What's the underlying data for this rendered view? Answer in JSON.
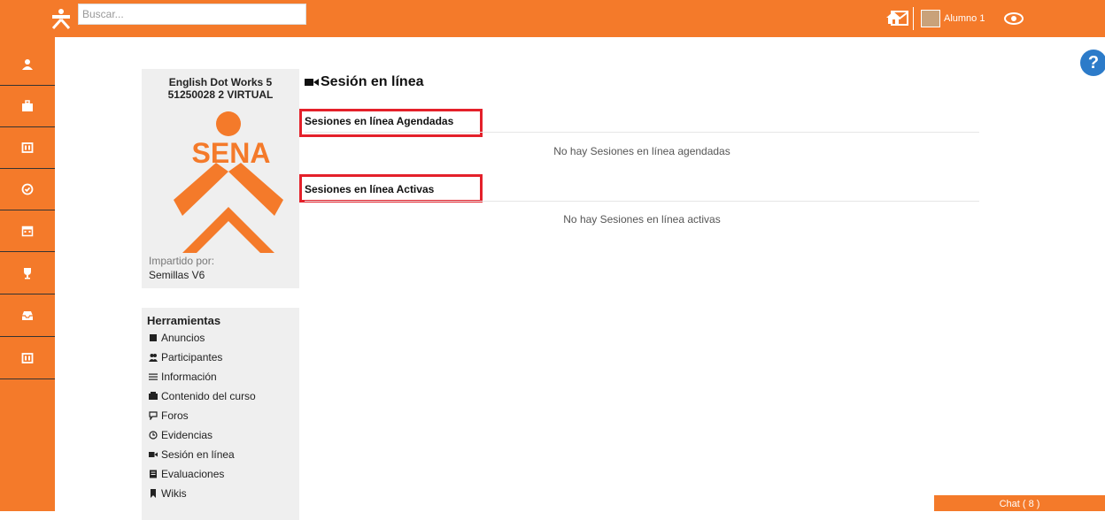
{
  "header": {
    "search_placeholder": "Buscar...",
    "user_name": "Alumno 1"
  },
  "sidebar": {
    "items": [
      {
        "icon": "user-icon"
      },
      {
        "icon": "briefcase-icon"
      },
      {
        "icon": "book-icon"
      },
      {
        "icon": "check-circle-icon"
      },
      {
        "icon": "calendar-icon"
      },
      {
        "icon": "trophy-icon"
      },
      {
        "icon": "inbox-icon"
      },
      {
        "icon": "book-icon"
      }
    ]
  },
  "course": {
    "title_line1": "English Dot Works 5",
    "title_line2": "51250028 2 VIRTUAL",
    "logo_text": "SENA",
    "taught_by_label": "Impartido por:",
    "taught_by_value": "Semillas V6"
  },
  "tools": {
    "title": "Herramientas",
    "items": [
      {
        "label": "Anuncios",
        "icon": "announcement-icon"
      },
      {
        "label": "Participantes",
        "icon": "users-icon"
      },
      {
        "label": "Información",
        "icon": "list-icon"
      },
      {
        "label": "Contenido del curso",
        "icon": "content-icon"
      },
      {
        "label": "Foros",
        "icon": "forum-icon"
      },
      {
        "label": "Evidencias",
        "icon": "clock-icon"
      },
      {
        "label": "Sesión en línea",
        "icon": "video-icon"
      },
      {
        "label": "Evaluaciones",
        "icon": "evaluation-icon"
      },
      {
        "label": "Wikis",
        "icon": "bookmark-icon"
      }
    ]
  },
  "main": {
    "title": "Sesión en línea",
    "scheduled_heading": "Sesiones en línea Agendadas",
    "scheduled_empty": "No hay Sesiones en línea agendadas",
    "active_heading": "Sesiones en línea Activas",
    "active_empty": "No hay Sesiones en línea activas"
  },
  "chat": {
    "label": "Chat ( 8 )"
  },
  "colors": {
    "brand_orange": "#f47a2a",
    "highlight_red": "#e4202a",
    "help_blue": "#2c7bc9"
  }
}
